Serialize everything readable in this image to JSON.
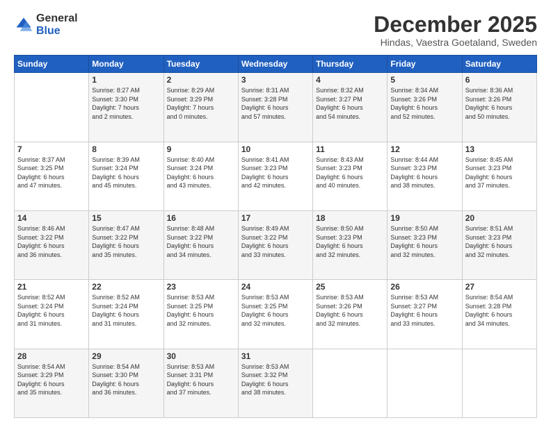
{
  "logo": {
    "general": "General",
    "blue": "Blue"
  },
  "header": {
    "month": "December 2025",
    "location": "Hindas, Vaestra Goetaland, Sweden"
  },
  "days_of_week": [
    "Sunday",
    "Monday",
    "Tuesday",
    "Wednesday",
    "Thursday",
    "Friday",
    "Saturday"
  ],
  "weeks": [
    [
      {
        "day": "",
        "info": ""
      },
      {
        "day": "1",
        "info": "Sunrise: 8:27 AM\nSunset: 3:30 PM\nDaylight: 7 hours\nand 2 minutes."
      },
      {
        "day": "2",
        "info": "Sunrise: 8:29 AM\nSunset: 3:29 PM\nDaylight: 7 hours\nand 0 minutes."
      },
      {
        "day": "3",
        "info": "Sunrise: 8:31 AM\nSunset: 3:28 PM\nDaylight: 6 hours\nand 57 minutes."
      },
      {
        "day": "4",
        "info": "Sunrise: 8:32 AM\nSunset: 3:27 PM\nDaylight: 6 hours\nand 54 minutes."
      },
      {
        "day": "5",
        "info": "Sunrise: 8:34 AM\nSunset: 3:26 PM\nDaylight: 6 hours\nand 52 minutes."
      },
      {
        "day": "6",
        "info": "Sunrise: 8:36 AM\nSunset: 3:26 PM\nDaylight: 6 hours\nand 50 minutes."
      }
    ],
    [
      {
        "day": "7",
        "info": "Sunrise: 8:37 AM\nSunset: 3:25 PM\nDaylight: 6 hours\nand 47 minutes."
      },
      {
        "day": "8",
        "info": "Sunrise: 8:39 AM\nSunset: 3:24 PM\nDaylight: 6 hours\nand 45 minutes."
      },
      {
        "day": "9",
        "info": "Sunrise: 8:40 AM\nSunset: 3:24 PM\nDaylight: 6 hours\nand 43 minutes."
      },
      {
        "day": "10",
        "info": "Sunrise: 8:41 AM\nSunset: 3:23 PM\nDaylight: 6 hours\nand 42 minutes."
      },
      {
        "day": "11",
        "info": "Sunrise: 8:43 AM\nSunset: 3:23 PM\nDaylight: 6 hours\nand 40 minutes."
      },
      {
        "day": "12",
        "info": "Sunrise: 8:44 AM\nSunset: 3:23 PM\nDaylight: 6 hours\nand 38 minutes."
      },
      {
        "day": "13",
        "info": "Sunrise: 8:45 AM\nSunset: 3:23 PM\nDaylight: 6 hours\nand 37 minutes."
      }
    ],
    [
      {
        "day": "14",
        "info": "Sunrise: 8:46 AM\nSunset: 3:22 PM\nDaylight: 6 hours\nand 36 minutes."
      },
      {
        "day": "15",
        "info": "Sunrise: 8:47 AM\nSunset: 3:22 PM\nDaylight: 6 hours\nand 35 minutes."
      },
      {
        "day": "16",
        "info": "Sunrise: 8:48 AM\nSunset: 3:22 PM\nDaylight: 6 hours\nand 34 minutes."
      },
      {
        "day": "17",
        "info": "Sunrise: 8:49 AM\nSunset: 3:22 PM\nDaylight: 6 hours\nand 33 minutes."
      },
      {
        "day": "18",
        "info": "Sunrise: 8:50 AM\nSunset: 3:23 PM\nDaylight: 6 hours\nand 32 minutes."
      },
      {
        "day": "19",
        "info": "Sunrise: 8:50 AM\nSunset: 3:23 PM\nDaylight: 6 hours\nand 32 minutes."
      },
      {
        "day": "20",
        "info": "Sunrise: 8:51 AM\nSunset: 3:23 PM\nDaylight: 6 hours\nand 32 minutes."
      }
    ],
    [
      {
        "day": "21",
        "info": "Sunrise: 8:52 AM\nSunset: 3:24 PM\nDaylight: 6 hours\nand 31 minutes."
      },
      {
        "day": "22",
        "info": "Sunrise: 8:52 AM\nSunset: 3:24 PM\nDaylight: 6 hours\nand 31 minutes."
      },
      {
        "day": "23",
        "info": "Sunrise: 8:53 AM\nSunset: 3:25 PM\nDaylight: 6 hours\nand 32 minutes."
      },
      {
        "day": "24",
        "info": "Sunrise: 8:53 AM\nSunset: 3:25 PM\nDaylight: 6 hours\nand 32 minutes."
      },
      {
        "day": "25",
        "info": "Sunrise: 8:53 AM\nSunset: 3:26 PM\nDaylight: 6 hours\nand 32 minutes."
      },
      {
        "day": "26",
        "info": "Sunrise: 8:53 AM\nSunset: 3:27 PM\nDaylight: 6 hours\nand 33 minutes."
      },
      {
        "day": "27",
        "info": "Sunrise: 8:54 AM\nSunset: 3:28 PM\nDaylight: 6 hours\nand 34 minutes."
      }
    ],
    [
      {
        "day": "28",
        "info": "Sunrise: 8:54 AM\nSunset: 3:29 PM\nDaylight: 6 hours\nand 35 minutes."
      },
      {
        "day": "29",
        "info": "Sunrise: 8:54 AM\nSunset: 3:30 PM\nDaylight: 6 hours\nand 36 minutes."
      },
      {
        "day": "30",
        "info": "Sunrise: 8:53 AM\nSunset: 3:31 PM\nDaylight: 6 hours\nand 37 minutes."
      },
      {
        "day": "31",
        "info": "Sunrise: 8:53 AM\nSunset: 3:32 PM\nDaylight: 6 hours\nand 38 minutes."
      },
      {
        "day": "",
        "info": ""
      },
      {
        "day": "",
        "info": ""
      },
      {
        "day": "",
        "info": ""
      }
    ]
  ]
}
